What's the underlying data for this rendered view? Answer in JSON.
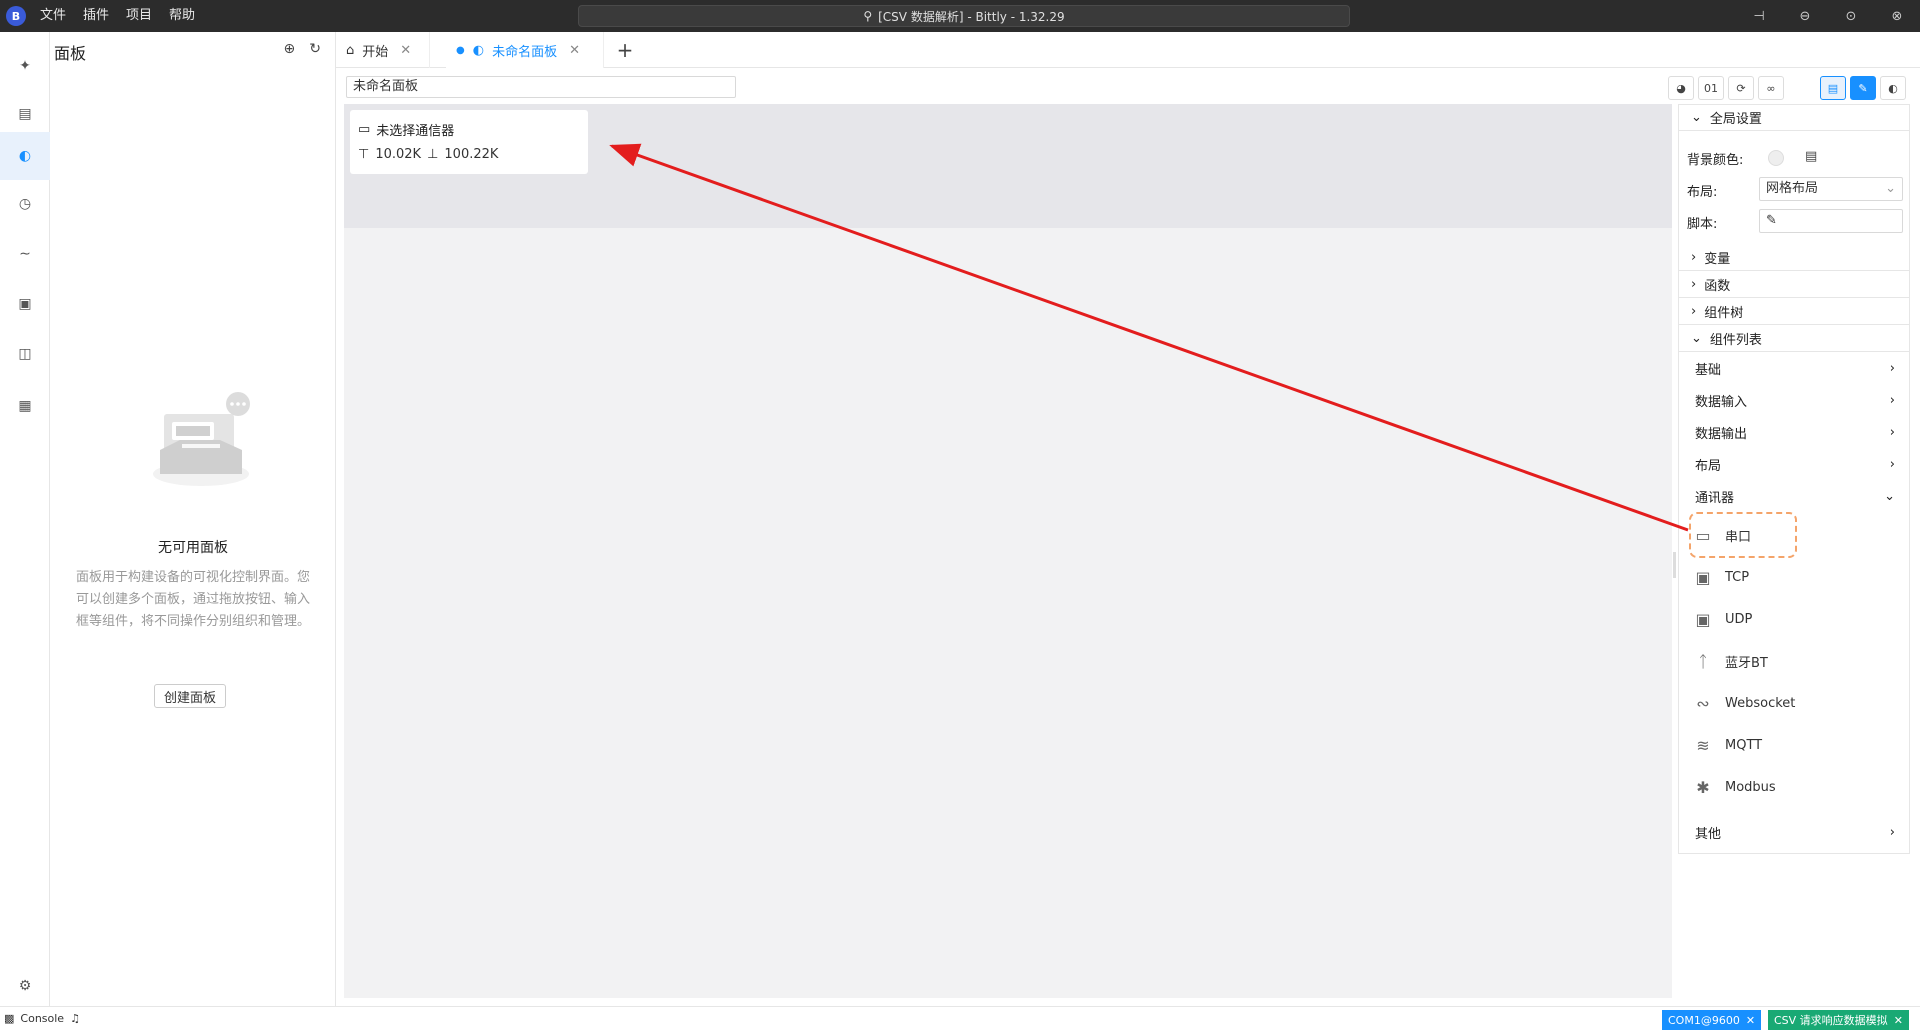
{
  "titlebar": {
    "logo": "B",
    "menu": [
      "文件",
      "插件",
      "项目",
      "帮助"
    ],
    "search_text": "[CSV 数据解析] - Bittly - 1.32.29",
    "window_controls": [
      "pin-icon",
      "minimize-icon",
      "maximize-icon",
      "close-icon"
    ]
  },
  "activity_bar": [
    "plugin-icon",
    "serial-icon",
    "panel-icon",
    "history-icon",
    "script-icon",
    "dashboard-icon",
    "document-icon",
    "scan-icon"
  ],
  "side_panel": {
    "title": "面板",
    "empty_title": "无可用面板",
    "empty_desc": "面板用于构建设备的可视化控制界面。您可以创建多个面板，通过拖放按钮、输入框等组件，将不同操作分别组织和管理。",
    "create_button": "创建面板"
  },
  "tabs": [
    {
      "label": "开始",
      "icon": "home-icon",
      "active": false
    },
    {
      "label": "未命名面板",
      "icon": "dashboard-icon",
      "active": true
    }
  ],
  "editor": {
    "panel_name": "未命名面板",
    "toolbar": [
      "globe-icon",
      "01",
      "debug-icon",
      "link-icon"
    ],
    "mode_buttons": [
      "save-icon",
      "edit-icon",
      "run-icon"
    ],
    "comm_card": {
      "title": "未选择通信器",
      "upload": "10.02K",
      "download": "100.22K"
    }
  },
  "properties": {
    "global_settings": "全局设置",
    "bg_color_label": "背景颜色:",
    "layout_label": "布局:",
    "layout_value": "网格布局",
    "script_label": "脚本:",
    "sections": [
      "变量",
      "函数",
      "组件树"
    ],
    "component_list": "组件列表",
    "categories": [
      "基础",
      "数据输入",
      "数据输出",
      "布局"
    ],
    "comm_category": "通讯器",
    "comm_items": [
      {
        "label": "串口",
        "icon": "serial-port-icon"
      },
      {
        "label": "TCP",
        "icon": "tcp-icon"
      },
      {
        "label": "UDP",
        "icon": "udp-icon"
      },
      {
        "label": "蓝牙BT",
        "icon": "bluetooth-icon"
      },
      {
        "label": "Websocket",
        "icon": "websocket-icon"
      },
      {
        "label": "MQTT",
        "icon": "mqtt-icon"
      },
      {
        "label": "Modbus",
        "icon": "modbus-icon"
      }
    ],
    "other_category": "其他"
  },
  "statusbar": {
    "console": "Console",
    "badges": [
      {
        "label": "COM1@9600",
        "color": "#1890ff"
      },
      {
        "label": "CSV 请求响应数据模拟",
        "color": "#19a974"
      }
    ]
  },
  "colors": {
    "accent": "#1890ff",
    "annotation_arrow": "#e31d1d",
    "highlight": "#f4a46a"
  }
}
